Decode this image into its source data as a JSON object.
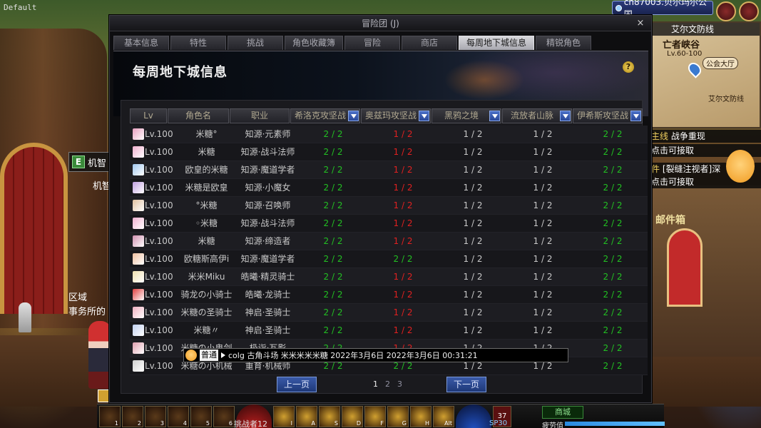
{
  "screen": {
    "default_label": "Default"
  },
  "world": {
    "server": "ch87003.贝尔玛尔公国",
    "map": {
      "header": "艾尔文防线",
      "title": "亡者峡谷",
      "level": "Lv.60-100",
      "hall": "公会大厅",
      "defense": "艾尔文防线"
    },
    "quests": [
      {
        "tag": "主线",
        "text": "战争重现"
      },
      {
        "tag": "",
        "text": "点击可接取"
      },
      {
        "tag": "件",
        "text": "[裂缝注视者]深"
      },
      {
        "tag": "",
        "text": "点击可接取"
      }
    ],
    "mail_label": "邮件箱",
    "npc_label": "机智",
    "npc_key": "E",
    "npc_name2": "机智",
    "area_text_1": "区域",
    "area_text_2": "事务所的"
  },
  "hotbar": {
    "slots": [
      "1",
      "2",
      "3",
      "4",
      "5",
      "6"
    ],
    "skill_keys": [
      "I",
      "A",
      "S",
      "D",
      "F",
      "G",
      "H",
      "Alt"
    ],
    "mall_label": "商城",
    "challenger": "挑战者12",
    "sp": "SP30",
    "fatigue": "疲劳值",
    "combo": "37"
  },
  "dialog": {
    "title": "冒险团 (J)",
    "close": "×",
    "tabs": [
      "基本信息",
      "特性",
      "挑战",
      "角色收藏簿",
      "冒险",
      "商店",
      "每周地下城信息",
      "精锐角色"
    ],
    "active_tab": 6,
    "banner_title": "每周地下城信息",
    "help": "?",
    "headers": {
      "lv": "Lv",
      "name": "角色名",
      "job": "职业",
      "dungeons": [
        "希洛克攻坚战",
        "奥兹玛攻坚战",
        "黑鸦之境",
        "流放者山脉",
        "伊希斯攻坚战"
      ]
    },
    "rows": [
      {
        "lv": "Lv.100",
        "name": "米糖°",
        "job": "知源·元素师",
        "d": [
          "2 / 2",
          "1 / 2",
          "1 / 2",
          "1 / 2",
          "2 / 2"
        ],
        "c": [
          "g",
          "r",
          "w",
          "w",
          "g"
        ],
        "avatar": "#e8a0c0"
      },
      {
        "lv": "Lv.100",
        "name": "米糖",
        "job": "知源·战斗法师",
        "d": [
          "2 / 2",
          "1 / 2",
          "1 / 2",
          "1 / 2",
          "2 / 2"
        ],
        "c": [
          "g",
          "r",
          "w",
          "w",
          "g"
        ],
        "avatar": "#f0b0d0"
      },
      {
        "lv": "Lv.100",
        "name": "欧皇的米糖",
        "job": "知源·魔道学者",
        "d": [
          "2 / 2",
          "1 / 2",
          "1 / 2",
          "1 / 2",
          "2 / 2"
        ],
        "c": [
          "g",
          "r",
          "w",
          "w",
          "g"
        ],
        "avatar": "#a0c8f0"
      },
      {
        "lv": "Lv.100",
        "name": "米糖是欧皇",
        "job": "知源·小魔女",
        "d": [
          "2 / 2",
          "1 / 2",
          "1 / 2",
          "1 / 2",
          "2 / 2"
        ],
        "c": [
          "g",
          "r",
          "w",
          "w",
          "g"
        ],
        "avatar": "#c0a0e0"
      },
      {
        "lv": "Lv.100",
        "name": "°米糖",
        "job": "知源·召唤师",
        "d": [
          "2 / 2",
          "1 / 2",
          "1 / 2",
          "1 / 2",
          "2 / 2"
        ],
        "c": [
          "g",
          "r",
          "w",
          "w",
          "g"
        ],
        "avatar": "#e0c0a0"
      },
      {
        "lv": "Lv.100",
        "name": "◦米糖",
        "job": "知源·战斗法师",
        "d": [
          "2 / 2",
          "1 / 2",
          "1 / 2",
          "1 / 2",
          "2 / 2"
        ],
        "c": [
          "g",
          "r",
          "w",
          "w",
          "g"
        ],
        "avatar": "#f0b0d0"
      },
      {
        "lv": "Lv.100",
        "name": "米糖",
        "job": "知源·缔造者",
        "d": [
          "2 / 2",
          "1 / 2",
          "1 / 2",
          "1 / 2",
          "2 / 2"
        ],
        "c": [
          "g",
          "r",
          "w",
          "w",
          "g"
        ],
        "avatar": "#d090b0"
      },
      {
        "lv": "Lv.100",
        "name": "欧糖斯高伊i",
        "job": "知源·魔道学者",
        "d": [
          "2 / 2",
          "2 / 2",
          "1 / 2",
          "1 / 2",
          "2 / 2"
        ],
        "c": [
          "g",
          "g",
          "w",
          "w",
          "g"
        ],
        "avatar": "#f0c0a0"
      },
      {
        "lv": "Lv.100",
        "name": "米米Miku",
        "job": "皓曦·精灵骑士",
        "d": [
          "2 / 2",
          "1 / 2",
          "1 / 2",
          "1 / 2",
          "2 / 2"
        ],
        "c": [
          "g",
          "r",
          "w",
          "w",
          "g"
        ],
        "avatar": "#f0e0b0"
      },
      {
        "lv": "Lv.100",
        "name": "骑龙の小骑士",
        "job": "皓曦·龙骑士",
        "d": [
          "2 / 2",
          "1 / 2",
          "1 / 2",
          "1 / 2",
          "2 / 2"
        ],
        "c": [
          "g",
          "r",
          "w",
          "w",
          "g"
        ],
        "avatar": "#e04040"
      },
      {
        "lv": "Lv.100",
        "name": "米糖の圣骑士",
        "job": "神启·圣骑士",
        "d": [
          "2 / 2",
          "1 / 2",
          "1 / 2",
          "1 / 2",
          "2 / 2"
        ],
        "c": [
          "g",
          "r",
          "w",
          "w",
          "g"
        ],
        "avatar": "#f0b0c0"
      },
      {
        "lv": "Lv.100",
        "name": "米糖〃",
        "job": "神启·圣骑士",
        "d": [
          "2 / 2",
          "1 / 2",
          "1 / 2",
          "1 / 2",
          "2 / 2"
        ],
        "c": [
          "g",
          "r",
          "w",
          "w",
          "g"
        ],
        "avatar": "#c0d0f0"
      },
      {
        "lv": "Lv.100",
        "name": "米糖の小鬼剑",
        "job": "极诣·瓦影",
        "d": [
          "2 / 2",
          "1 / 2",
          "1 / 2",
          "1 / 2",
          "2 / 2"
        ],
        "c": [
          "g",
          "r",
          "w",
          "w",
          "g"
        ],
        "avatar": "#e0a0b0"
      },
      {
        "lv": "Lv.100",
        "name": "米糖の小机械",
        "job": "重育·机械师",
        "d": [
          "2 / 2",
          "2 / 2",
          "1 / 2",
          "1 / 2",
          "2 / 2"
        ],
        "c": [
          "g",
          "g",
          "w",
          "w",
          "g"
        ],
        "avatar": "#d0d0d0"
      }
    ],
    "pager": {
      "prev": "上一页",
      "next": "下一页",
      "pages": [
        "1",
        "2",
        "3"
      ],
      "current": 0
    }
  },
  "chat": {
    "channel": "普通",
    "message": "colg 古角斗场 米米米米米糖 2022年3月6日 2022年3月6日 00:31:21"
  }
}
